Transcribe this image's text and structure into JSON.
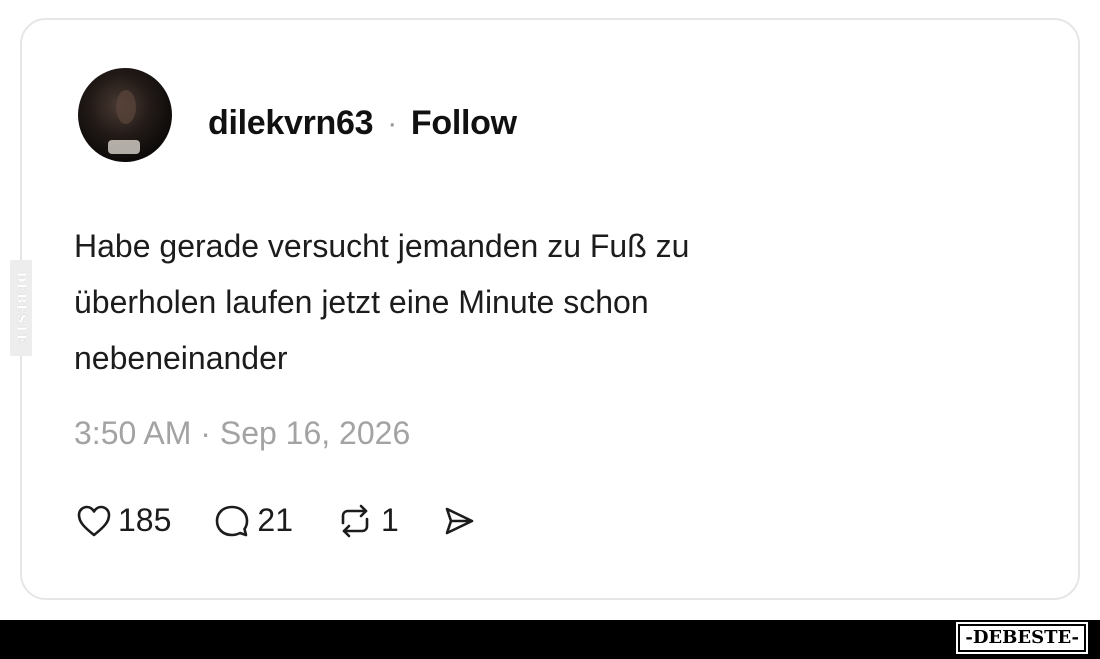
{
  "post": {
    "username": "dilekvrn63",
    "separator": "·",
    "follow_label": "Follow",
    "text_lines": [
      "Habe gerade versucht jemanden zu Fuß zu",
      "überholen laufen jetzt eine Minute schon",
      "nebeneinander"
    ],
    "timestamp": "3:50 AM · Sep 16, 2026",
    "likes": "185",
    "replies": "21",
    "reposts": "1"
  },
  "icons": {
    "like": "heart-icon",
    "reply": "speech-bubble-icon",
    "repost": "repost-icon",
    "share": "send-icon"
  },
  "watermark": {
    "side_text": "DEBESTE",
    "logo_text": "-DEBESTE-"
  },
  "colors": {
    "background": "#ffffff",
    "card_border": "#e6e6e6",
    "timestamp": "#a3a3a3",
    "bar": "#000000"
  }
}
